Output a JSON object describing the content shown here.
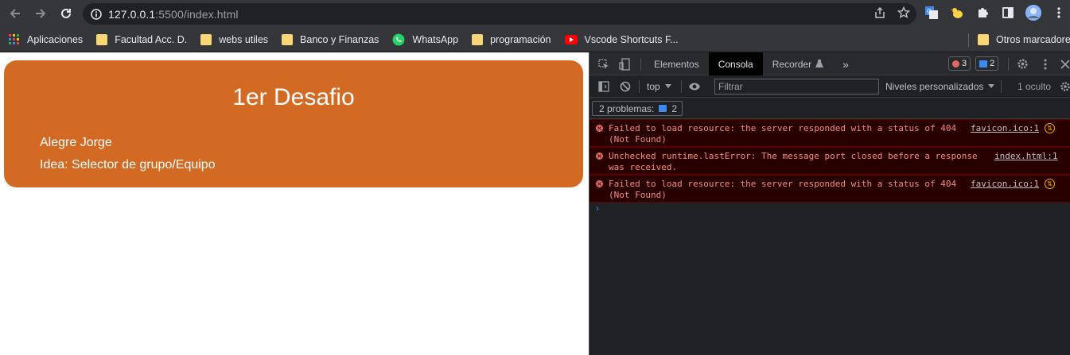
{
  "browser": {
    "url_host": "127.0.0.1",
    "url_rest": ":5500/index.html"
  },
  "bookmarks": [
    {
      "label": "Aplicaciones",
      "icon": "apps-grid-icon"
    },
    {
      "label": "Facultad Acc. D.",
      "icon": "folder-icon"
    },
    {
      "label": "webs utiles",
      "icon": "folder-icon"
    },
    {
      "label": "Banco y Finanzas",
      "icon": "folder-icon"
    },
    {
      "label": "WhatsApp",
      "icon": "whatsapp-icon"
    },
    {
      "label": "programación",
      "icon": "folder-icon"
    },
    {
      "label": "Vscode Shortcuts F...",
      "icon": "youtube-icon"
    }
  ],
  "other_bookmarks": "Otros marcadores",
  "page": {
    "title": "1er Desafio",
    "line1": "Alegre Jorge",
    "line2": "Idea: Selector de grupo/Equipo",
    "card_color": "#d36a23"
  },
  "devtools": {
    "tabs": [
      "Elementos",
      "Consola",
      "Recorder"
    ],
    "active_tab": "Consola",
    "error_count": "3",
    "message_count": "2",
    "context": "top",
    "filter_placeholder": "Filtrar",
    "levels": "Niveles personalizados",
    "hidden": "1 oculto",
    "problems_label": "2 problemas:",
    "problems_count": "2",
    "messages": [
      {
        "text": "Failed to load resource: the server responded with a status of 404\n(Not Found)",
        "source": "favicon.ico:1"
      },
      {
        "text": "Unchecked runtime.lastError: The message port closed before a response\nwas received.",
        "source": "index.html:1"
      },
      {
        "text": "Failed to load resource: the server responded with a status of 404\n(Not Found)",
        "source": "favicon.ico:1"
      }
    ],
    "prompt_symbol": "›"
  }
}
